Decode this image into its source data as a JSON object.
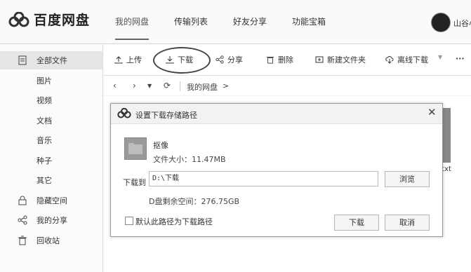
{
  "app": {
    "name": "百度网盘"
  },
  "nav": [
    "我的网盘",
    "传输列表",
    "好友分享",
    "功能宝箱"
  ],
  "user": {
    "name": "山谷小"
  },
  "sidebar": {
    "items": [
      {
        "label": "全部文件",
        "icon": "file-icon"
      },
      {
        "label": "图片"
      },
      {
        "label": "视频"
      },
      {
        "label": "文档"
      },
      {
        "label": "音乐"
      },
      {
        "label": "种子"
      },
      {
        "label": "其它"
      },
      {
        "label": "隐藏空间",
        "icon": "lock-icon"
      },
      {
        "label": "我的分享",
        "icon": "share-icon"
      },
      {
        "label": "回收站",
        "icon": "trash-icon"
      }
    ]
  },
  "toolbar": {
    "upload": "上传",
    "download": "下载",
    "share": "分享",
    "delete": "删除",
    "new_folder": "新建文件夹",
    "offline": "离线下载",
    "more": "···"
  },
  "path": {
    "current": "我的网盘",
    "sep": ">"
  },
  "background_file": {
    "ext": ".txt"
  },
  "dialog": {
    "title": "设置下载存储路径",
    "file_name": "抠像",
    "file_size": "文件大小：11.47MB",
    "download_to_label": "下载到",
    "path_value": "D:\\下载",
    "browse": "浏览",
    "free_space": "D盘剩余空间：276.75GB",
    "default_checkbox": "默认此路径为下载路径",
    "confirm": "下载",
    "cancel": "取消",
    "close": "✕"
  }
}
